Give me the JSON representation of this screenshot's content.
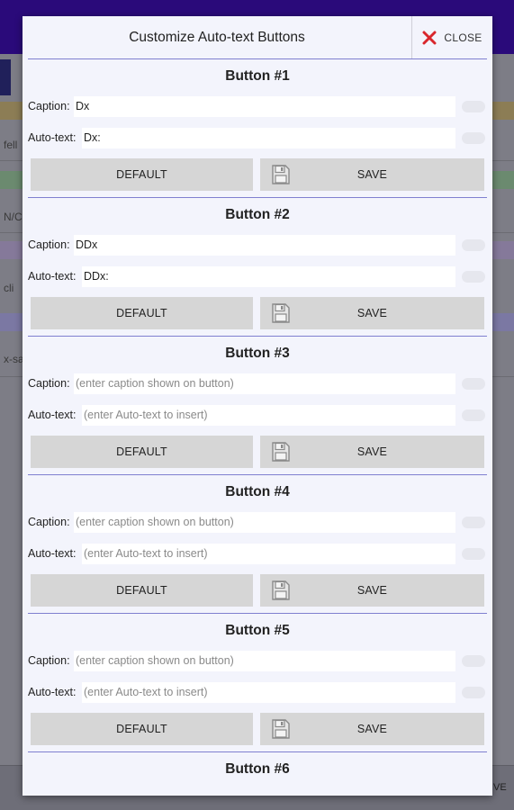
{
  "background": {
    "fragments": [
      "fell",
      "N/C",
      "cli",
      "x-sa"
    ],
    "bottom_right": "VE"
  },
  "dialog": {
    "title": "Customize Auto-text Buttons",
    "close_label": "CLOSE",
    "caption_label": "Caption:",
    "autotext_label": "Auto-text:",
    "default_label": "DEFAULT",
    "save_label": "SAVE",
    "buttons": [
      {
        "title": "Button #1",
        "caption_value": "Dx",
        "caption_placeholder": "",
        "autotext_value": "Dx:",
        "autotext_placeholder": ""
      },
      {
        "title": "Button #2",
        "caption_value": "DDx",
        "caption_placeholder": "",
        "autotext_value": "DDx:",
        "autotext_placeholder": ""
      },
      {
        "title": "Button #3",
        "caption_value": "",
        "caption_placeholder": "(enter caption shown on button)",
        "autotext_value": "",
        "autotext_placeholder": "(enter Auto-text to insert)"
      },
      {
        "title": "Button #4",
        "caption_value": "",
        "caption_placeholder": "(enter caption shown on button)",
        "autotext_value": "",
        "autotext_placeholder": "(enter Auto-text to insert)"
      },
      {
        "title": "Button #5",
        "caption_value": "",
        "caption_placeholder": "(enter caption shown on button)",
        "autotext_value": "",
        "autotext_placeholder": "(enter Auto-text to insert)"
      },
      {
        "title": "Button #6"
      }
    ]
  },
  "colors": {
    "accent": "#7f7fd0",
    "dialog_bg": "#f3f4fc",
    "button_bg": "#d6d6d6",
    "close_x": "#d9262c",
    "topbar": "#2a0a7a"
  },
  "icons": {
    "close": "close-x-icon",
    "save": "floppy-disk-icon"
  }
}
